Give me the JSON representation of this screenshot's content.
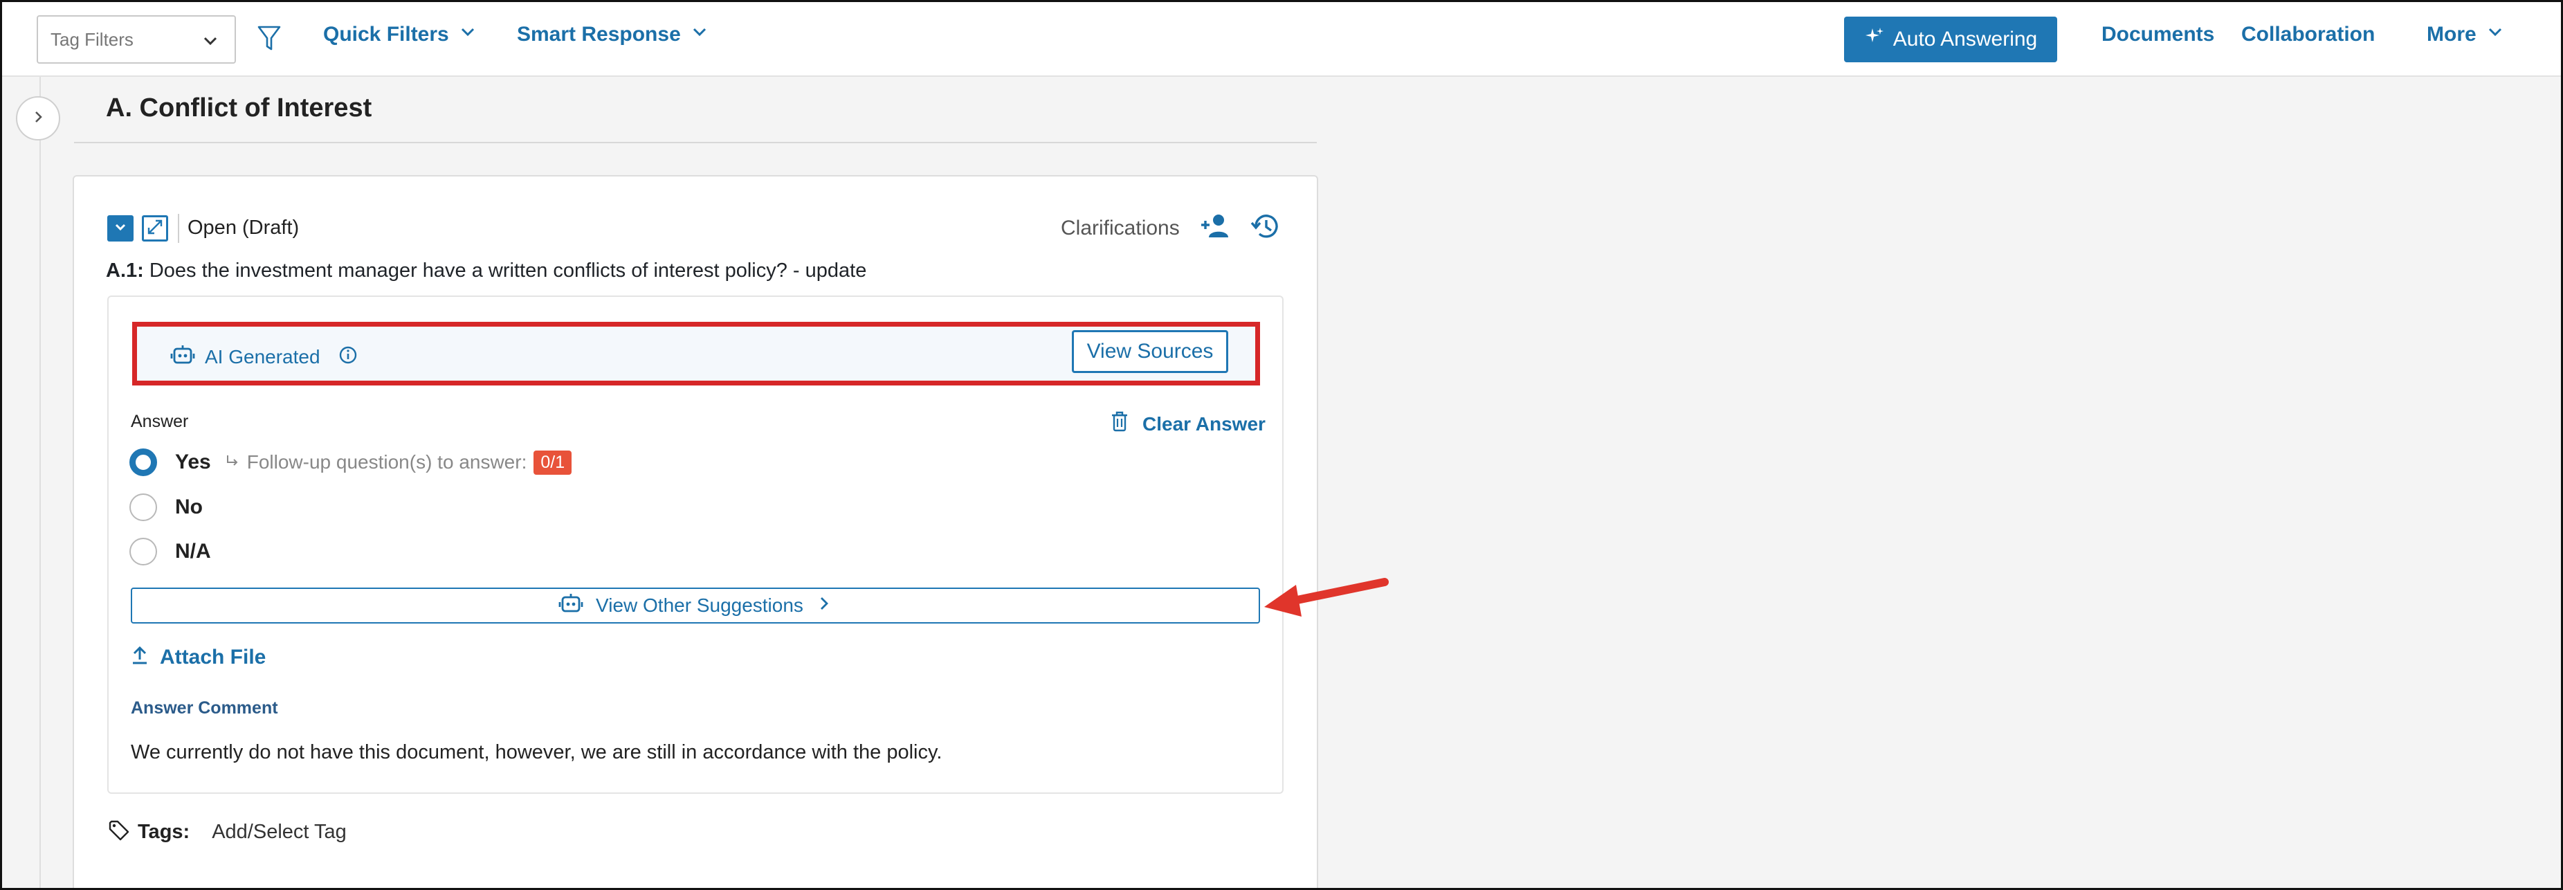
{
  "topbar": {
    "tag_filter_placeholder": "Tag Filters",
    "quick_filters": "Quick Filters",
    "smart_response": "Smart Response",
    "auto_answering": "Auto Answering",
    "documents": "Documents",
    "collaboration": "Collaboration",
    "more": "More"
  },
  "section": {
    "title": "A. Conflict of Interest"
  },
  "card": {
    "status": "Open (Draft)",
    "clarifications": "Clarifications",
    "question_id": "A.1:",
    "question_text": "Does the investment manager have a written conflicts of interest policy? - update"
  },
  "ai_bar": {
    "label": "AI Generated",
    "view_sources": "View Sources"
  },
  "answer": {
    "label": "Answer",
    "clear": "Clear Answer",
    "options": [
      {
        "label": "Yes",
        "selected": true
      },
      {
        "label": "No",
        "selected": false
      },
      {
        "label": "N/A",
        "selected": false
      }
    ],
    "followup_text": "Follow-up question(s) to answer:",
    "followup_count": "0/1",
    "view_other_suggestions": "View Other Suggestions",
    "attach_file": "Attach File",
    "comment_label": "Answer Comment",
    "comment_text": "We currently do not have this document, however, we are still in accordance with the policy."
  },
  "tags": {
    "label": "Tags:",
    "add": "Add/Select Tag"
  },
  "colors": {
    "accent": "#1f77b4",
    "highlight_border": "#d62728",
    "badge": "#e8533a"
  },
  "icons": [
    "chevron-down-icon",
    "filter-icon",
    "sparkle-icon",
    "chevron-right-icon",
    "collapse-icon",
    "expand-icon",
    "add-user-icon",
    "history-icon",
    "robot-icon",
    "info-icon",
    "trash-icon",
    "upload-icon",
    "tag-icon",
    "red-arrow-annotation"
  ]
}
